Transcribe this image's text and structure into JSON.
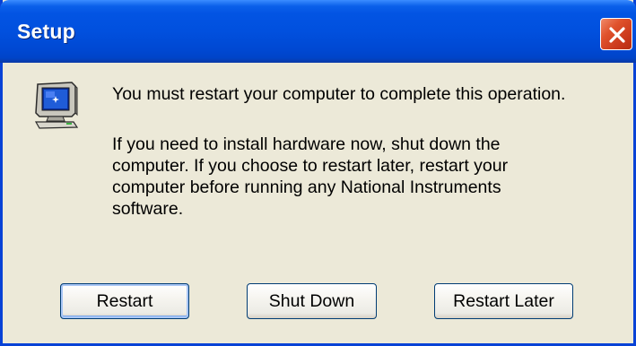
{
  "window": {
    "title": "Setup",
    "close_icon": "close-icon"
  },
  "dialog": {
    "icon": "computer-monitor-icon",
    "primary_message": "You must restart your computer to complete this operation.",
    "secondary_message": "If you need to install hardware now, shut down the\ncomputer. If you choose to restart later, restart your\ncomputer before running any National Instruments\nsoftware."
  },
  "buttons": {
    "restart": "Restart",
    "shut_down": "Shut Down",
    "restart_later": "Restart Later"
  },
  "colors": {
    "titlebar_blue": "#0054e3",
    "dialog_face": "#ece9d8",
    "close_red": "#e0522c",
    "button_border": "#003c74"
  }
}
